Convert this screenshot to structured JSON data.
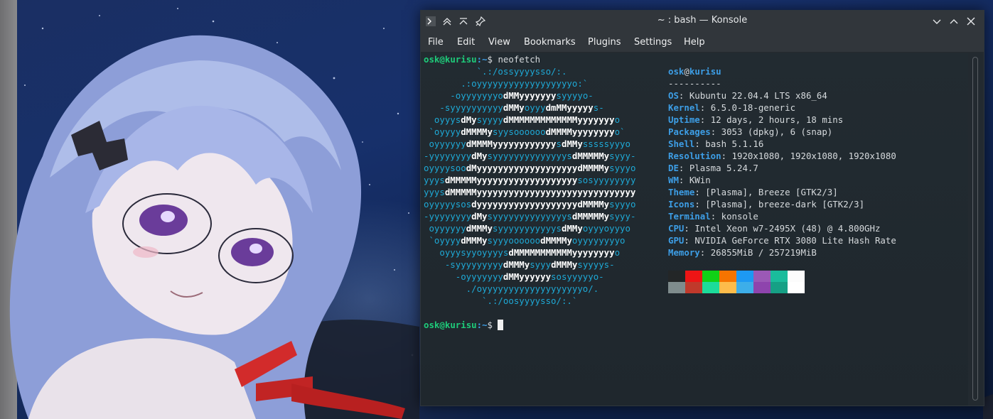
{
  "window": {
    "title": "~ : bash — Konsole"
  },
  "menu": [
    "File",
    "Edit",
    "View",
    "Bookmarks",
    "Plugins",
    "Settings",
    "Help"
  ],
  "prompt": {
    "user": "osk",
    "at": "@",
    "host": "kurisu",
    "path": ":~",
    "symbol": "$ ",
    "command": "neofetch"
  },
  "ascii_art": [
    "          `.:/ossyyyysso/:.",
    "       .:oyyyyyyyyyyyyyyyyyyo:`",
    "     -oyyyyyyyodMMyyyyyyysyyyyo-",
    "   -syyyyyyyyyydMMyoyyydmMMyyyyys-",
    "  oyyysdMysyyyydMMMMMMMMMMMMMyyyyyyyo",
    " `oyyyydMMMMysyysoooooodMMMMyyyyyyyyo`",
    " oyyyyyydMMMMyyyyyyyyyyyysdMMysssssyyyo",
    "-yyyyyyyydMysyyyyyyyyyyyyyysdMMMMMysyyy-",
    "oyyyysoodMyyyyyyyyyyyyyyyyyyydMMMMysyyyo",
    "yyysdMMMMMyyyyyyyyyyyyyyyyyyysosyyyyyyyy",
    "yyysdMMMMMyyyyyyyyyyyyyyyyyyyyyyyyyyyyyy",
    "oyyyyysosdyyyyyyyyyyyyyyyyyyydMMMMysyyyo",
    "-yyyyyyyydMysyyyyyyyyyyyyyysdMMMMMysyyy-",
    " oyyyyyydMMMysyyyyyyyyyyysdMMyoyyyoyyyo",
    " `oyyyydMMMysyyyoooooodMMMMyoyyyyyyyyo",
    "   oyyysyyoyyyysdMMMMMMMMMMMyyyyyyyyo",
    "    -syyyyyyyyydMMMysyyydMMMysyyyys-",
    "      -oyyyyyyydMMyyyyyysosyyyyyo-",
    "        ./oyyyyyyyyyyyyyyyyyyyo/.",
    "           `.:/oosyyyysso/:.`"
  ],
  "info": {
    "user": "osk",
    "host": "kurisu",
    "separator": "----------",
    "fields": [
      {
        "key": "OS",
        "value": "Kubuntu 22.04.4 LTS x86_64"
      },
      {
        "key": "Kernel",
        "value": "6.5.0-18-generic"
      },
      {
        "key": "Uptime",
        "value": "12 days, 2 hours, 18 mins"
      },
      {
        "key": "Packages",
        "value": "3053 (dpkg), 6 (snap)"
      },
      {
        "key": "Shell",
        "value": "bash 5.1.16"
      },
      {
        "key": "Resolution",
        "value": "1920x1080, 1920x1080, 1920x1080"
      },
      {
        "key": "DE",
        "value": "Plasma 5.24.7"
      },
      {
        "key": "WM",
        "value": "KWin"
      },
      {
        "key": "Theme",
        "value": "[Plasma], Breeze [GTK2/3]"
      },
      {
        "key": "Icons",
        "value": "[Plasma], breeze-dark [GTK2/3]"
      },
      {
        "key": "Terminal",
        "value": "konsole"
      },
      {
        "key": "CPU",
        "value": "Intel Xeon w7-2495X (48) @ 4.800GHz"
      },
      {
        "key": "GPU",
        "value": "NVIDIA GeForce RTX 3080 Lite Hash Rate"
      },
      {
        "key": "Memory",
        "value": "26855MiB / 257219MiB"
      }
    ]
  },
  "palette_normal": [
    "#232627",
    "#ed1515",
    "#11d116",
    "#f67400",
    "#1d99f3",
    "#9b59b6",
    "#1abc9c",
    "#fcfcfc"
  ],
  "palette_bright": [
    "#7f8c8d",
    "#c0392b",
    "#1cdc9a",
    "#fdbc4b",
    "#3daee9",
    "#8e44ad",
    "#16a085",
    "#ffffff"
  ],
  "colors": {
    "prompt_green": "#1ecc7a",
    "ascii_cyan": "#1ea9d6",
    "label_blue": "#3d9ee6"
  }
}
